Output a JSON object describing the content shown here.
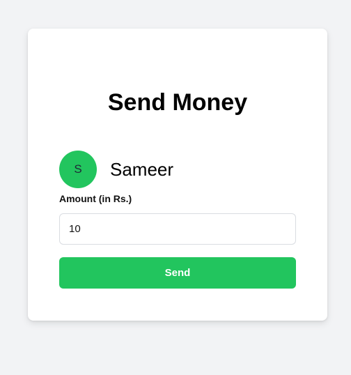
{
  "title": "Send Money",
  "recipient": {
    "initial": "S",
    "name": "Sameer"
  },
  "amount": {
    "label": "Amount (in Rs.)",
    "value": "10"
  },
  "send_label": "Send",
  "colors": {
    "accent": "#22c55e",
    "background": "#f2f3f5",
    "card": "#ffffff"
  }
}
